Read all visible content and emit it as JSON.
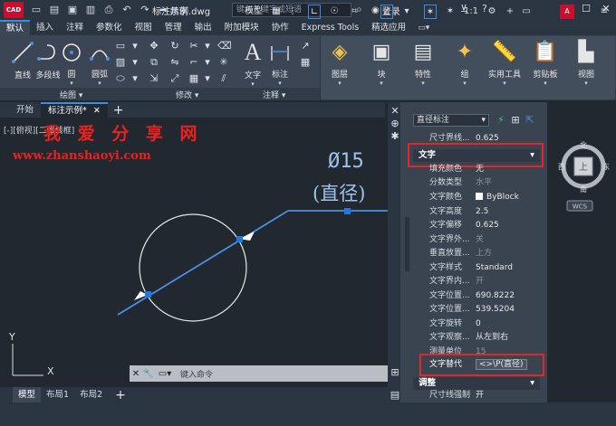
{
  "titlebar": {
    "app_logo": "CAD",
    "share": "共享",
    "doc_title": "标注示例.dwg",
    "search_placeholder": "键入关键字或短语",
    "login": "登录"
  },
  "ribbon_tabs": [
    "默认",
    "插入",
    "注释",
    "参数化",
    "视图",
    "管理",
    "输出",
    "附加模块",
    "协作",
    "Express Tools",
    "精选应用"
  ],
  "ribbon": {
    "draw_tools": [
      "直线",
      "多段线",
      "圆",
      "圆弧"
    ],
    "text_tool": "文字",
    "dim_tool": "标注",
    "layer_tool": "图层",
    "block_tool": "块",
    "props_tool": "特性",
    "group_tool": "组",
    "utils_tool": "实用工具",
    "clipboard_tool": "剪贴板",
    "view_tool": "视图",
    "panel_labels": {
      "draw": "绘图",
      "modify": "修改",
      "annotate": "注释"
    }
  },
  "doc_tabs": [
    "开始",
    "标注示例*"
  ],
  "canvas": {
    "view_label": "[-][俯视][二维线框]",
    "watermark_cn": "我 爱 分 享 网",
    "watermark_url": "www.zhanshaoyi.com",
    "dim_text_line1": "Ø15",
    "dim_text_line2": "(直径)"
  },
  "command_line": {
    "placeholder": "键入命令"
  },
  "layout_tabs": [
    "模型",
    "布局1",
    "布局2"
  ],
  "statusbar": {
    "model": "模型",
    "scale": "1:1"
  },
  "viewcube": {
    "north": "北",
    "south": "南",
    "west": "西",
    "east": "东",
    "top": "上",
    "wcs": "WCS"
  },
  "properties": {
    "selector": "直径标注",
    "rows_top": [
      {
        "name": "尺寸界线...",
        "value": "0.625"
      }
    ],
    "section_text": "文字",
    "rows_text": [
      {
        "name": "填充颜色",
        "value": "无"
      },
      {
        "name": "分数类型",
        "value": "水平",
        "dim": true
      },
      {
        "name": "文字颜色",
        "value": "ByBlock"
      },
      {
        "name": "文字高度",
        "value": "2.5"
      },
      {
        "name": "文字偏移",
        "value": "0.625"
      },
      {
        "name": "文字界外...",
        "value": "关",
        "dim": true
      },
      {
        "name": "垂直放置...",
        "value": "上方",
        "dim": true
      },
      {
        "name": "文字样式",
        "value": "Standard"
      },
      {
        "name": "文字界内...",
        "value": "开",
        "dim": true
      },
      {
        "name": "文字位置...",
        "value": "690.8222"
      },
      {
        "name": "文字位置...",
        "value": "539.5204"
      },
      {
        "name": "文字旋转",
        "value": "0"
      },
      {
        "name": "文字观察...",
        "value": "从左到右"
      },
      {
        "name": "测量单位",
        "value": "15",
        "dim": true
      }
    ],
    "override_name": "文字替代",
    "override_value": "<>\\P(直径)",
    "section_fit": "调整",
    "rows_fit": [
      {
        "name": "尺寸线强制",
        "value": "开"
      }
    ]
  },
  "colors": {
    "accent": "#3b8de0",
    "highlight_red": "#e0282a",
    "dimension": "#4a90e2"
  }
}
